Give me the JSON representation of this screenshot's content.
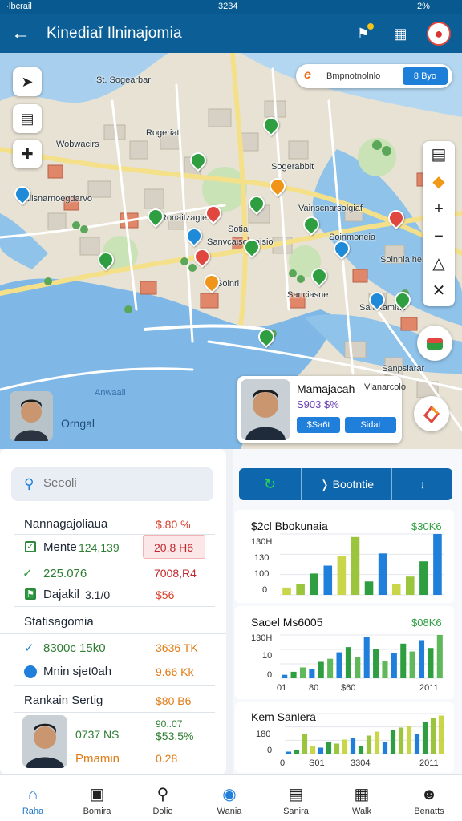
{
  "status": {
    "carrier": "∙lbcrail",
    "time": "3234",
    "battery": "2%"
  },
  "header": {
    "title": "Kinediaĭ Ilninajomia"
  },
  "map": {
    "labels": [
      "Rogeriat",
      "Sogerabbit",
      "Vainscnarsolgiaf",
      "Galisnarnoegdarvo",
      "Sotiai",
      "Soinmoneia",
      "Sanvcaisemaisio",
      "Soinnia hertocia",
      "Soinri",
      "Sanciasne",
      "Sa Fkamias",
      "Ronaitzagier",
      "St. Sogearbar",
      "Sanpsiarar",
      "Wobwacirs"
    ],
    "water_labels": [
      "Anwaali"
    ],
    "search_text": "Bmpnotnolnlo",
    "search_button": "8 Byo"
  },
  "person_tag": "Orngal",
  "card": {
    "name": "Mamajacah",
    "place": "Vlanarcolo",
    "price": "S903 $%",
    "btn1": "$Sa6t",
    "btn2": "Sidat"
  },
  "left_panel": {
    "search_placeholder": "Seeoli",
    "items": [
      {
        "label": "Nannagajoliaua",
        "value": "$.80 %",
        "color": "#d9412e"
      },
      {
        "label": "Mente",
        "value2": "124,139",
        "value": "20.8 H6",
        "color": "#c1272d"
      },
      {
        "label": "225.076",
        "value": "7008,R4",
        "color": "#c1272d"
      },
      {
        "label": "Dajakil",
        "value2": "3.1/0",
        "value": "$56",
        "color": "#d9412e"
      }
    ],
    "section2_title": "Statisagomia",
    "items2": [
      {
        "label": "8300c 15k0",
        "value": "3636 TK"
      },
      {
        "label": "Mnin sjet0ah",
        "value": "9.66 Kk"
      }
    ],
    "section3_title": "Rankain Sertig",
    "section3_value": "$80 B6",
    "person": {
      "name": "Pmamin",
      "line1": "0737 NS",
      "line2a": "90..07",
      "line2b": "$53.5%",
      "value": "0.28"
    }
  },
  "right_panel": {
    "seg": [
      "↻",
      "❭ Bootntie",
      "↓"
    ],
    "charts": [
      {
        "title": "$2cl Bbokunaia",
        "value": "$30K6",
        "ytick_labels": [
          "130H",
          "130",
          "100",
          "0"
        ],
        "xtick_labels": []
      },
      {
        "title": "Saoel Ms6005",
        "value": "$08K6",
        "ytick_labels": [
          "130H",
          "10",
          "0"
        ],
        "xtick_labels": [
          "01",
          "80",
          "$60",
          "2011"
        ]
      },
      {
        "title": "Kem Sanlera",
        "value": "",
        "ytick_labels": [
          "180",
          "0"
        ],
        "xtick_labels": [
          "0",
          "S01",
          "3304",
          "2011"
        ]
      }
    ]
  },
  "chart_data": [
    {
      "type": "bar",
      "title": "$2cl Bbokunaia",
      "categories": [
        "1",
        "2",
        "3",
        "4",
        "5",
        "6",
        "7",
        "8",
        "9",
        "10",
        "11",
        "12"
      ],
      "values": [
        12,
        18,
        35,
        48,
        64,
        95,
        22,
        68,
        18,
        30,
        55,
        100
      ],
      "ylim": [
        0,
        100
      ]
    },
    {
      "type": "bar",
      "title": "Saoel Ms6005",
      "categories": [
        "1",
        "2",
        "3",
        "4",
        "5",
        "6",
        "7",
        "8",
        "9",
        "10",
        "11",
        "12",
        "13",
        "14",
        "15",
        "16",
        "17",
        "18"
      ],
      "values": [
        8,
        15,
        25,
        22,
        38,
        45,
        60,
        72,
        50,
        95,
        68,
        40,
        58,
        80,
        62,
        88,
        70,
        100
      ],
      "ylim": [
        0,
        100
      ]
    },
    {
      "type": "bar",
      "title": "Kem Sanlera",
      "categories": [
        "1",
        "2",
        "3",
        "4",
        "5",
        "6",
        "7",
        "8",
        "9",
        "10",
        "11",
        "12",
        "13",
        "14",
        "15",
        "16",
        "17",
        "18",
        "19",
        "20"
      ],
      "values": [
        5,
        10,
        50,
        20,
        15,
        30,
        25,
        35,
        40,
        20,
        45,
        55,
        30,
        60,
        65,
        70,
        50,
        80,
        90,
        95
      ],
      "ylim": [
        0,
        100
      ]
    }
  ],
  "nav": [
    {
      "label": "Raha",
      "icon": "home-icon"
    },
    {
      "label": "Bomira",
      "icon": "monitor-icon"
    },
    {
      "label": "Dolio",
      "icon": "search-icon"
    },
    {
      "label": "Wania",
      "icon": "pin-icon"
    },
    {
      "label": "Sanira",
      "icon": "document-icon"
    },
    {
      "label": "Walk",
      "icon": "chart-icon"
    },
    {
      "label": "Benatts",
      "icon": "profile-icon"
    }
  ]
}
